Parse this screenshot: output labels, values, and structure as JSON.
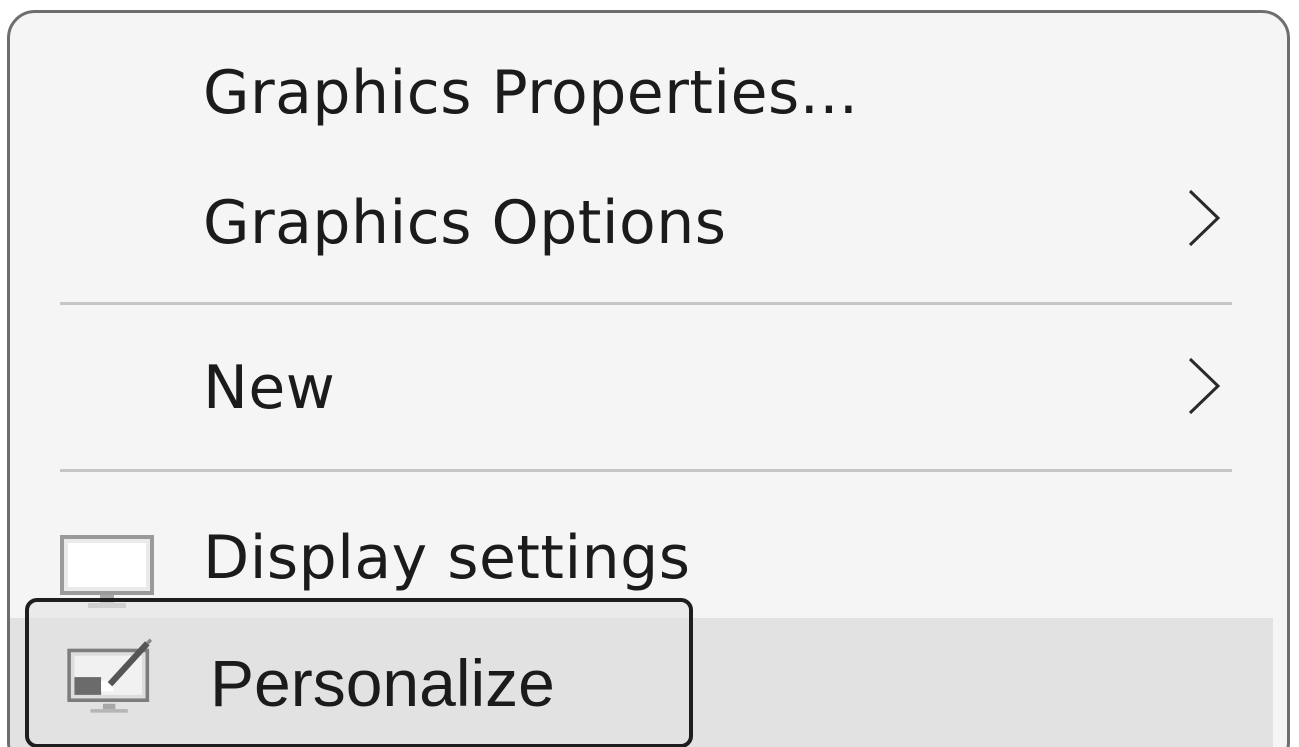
{
  "context_menu": {
    "items": [
      {
        "label": "Graphics Properties...",
        "has_submenu": false,
        "icon": null
      },
      {
        "label": "Graphics Options",
        "has_submenu": true,
        "icon": null
      },
      {
        "label": "New",
        "has_submenu": true,
        "icon": null
      },
      {
        "label": "Display settings",
        "has_submenu": false,
        "icon": "display-icon"
      },
      {
        "label": "Personalize",
        "has_submenu": false,
        "icon": "personalize-icon",
        "highlighted": true
      }
    ]
  },
  "colors": {
    "menu_background": "#f4f5f4",
    "menu_border": "#6e6e6e",
    "separator": "#c6c6c6",
    "hover_background": "#e1e2e1",
    "highlight_outline": "#1e1e1e",
    "text": "#1b1b1b"
  }
}
